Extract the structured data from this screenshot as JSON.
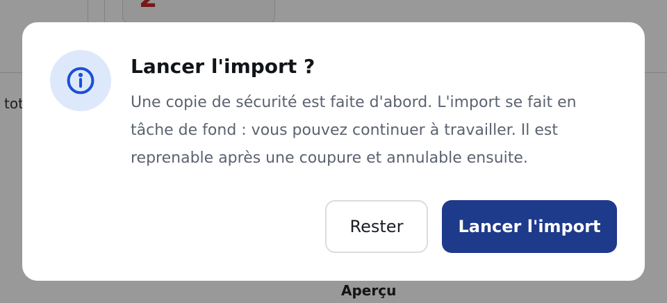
{
  "background": {
    "digit": "2",
    "side_text": "tot",
    "tab_label": "Aperçu"
  },
  "dialog": {
    "icon": "info-icon",
    "title": "Lancer l'import ?",
    "message": "Une copie de sécurité est faite d'abord. L'import se fait en tâche de fond : vous pouvez continuer à travailler. Il est reprenable après une coupure et annulable ensuite.",
    "cancel_label": "Rester",
    "confirm_label": "Lancer l'import"
  },
  "colors": {
    "primary": "#1e3a8a",
    "icon_bg": "#dde9fb",
    "icon_fg": "#1d4ed8",
    "danger": "#c62828"
  }
}
